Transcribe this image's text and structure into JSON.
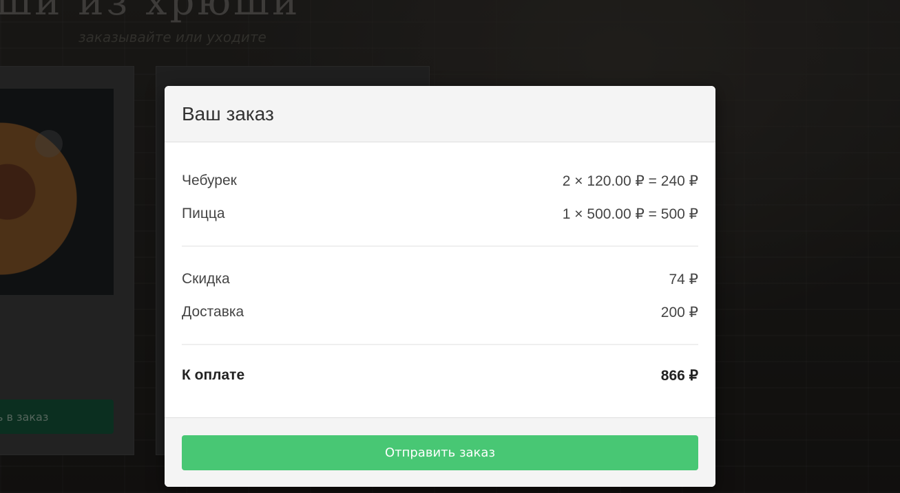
{
  "background": {
    "site_title": "ши из хрюши",
    "site_tagline": "заказывайте или уходите",
    "add_to_order_label": "ь в заказ"
  },
  "modal": {
    "title": "Ваш заказ",
    "items": [
      {
        "name": "Чебурек",
        "line": "2 × 120.00 ₽ = 240 ₽"
      },
      {
        "name": "Пицца",
        "line": "1 × 500.00 ₽ = 500 ₽"
      }
    ],
    "discount": {
      "label": "Скидка",
      "value": "74 ₽"
    },
    "delivery": {
      "label": "Доставка",
      "value": "200 ₽"
    },
    "total": {
      "label": "К оплате",
      "value": "866 ₽"
    },
    "submit_label": "Отправить заказ"
  },
  "colors": {
    "accent_green": "#48c774",
    "overlay": "rgba(0,0,0,0.45)",
    "modal_header_bg": "#f4f4f4"
  }
}
